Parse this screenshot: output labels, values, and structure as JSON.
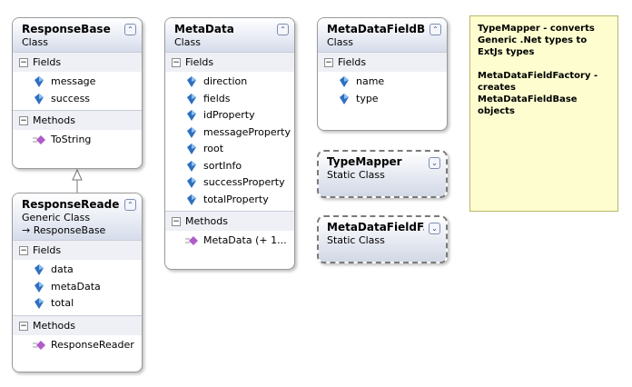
{
  "classes": {
    "response_base": {
      "name": "ResponseBase",
      "kind": "Class",
      "fields_label": "Fields",
      "fields": [
        "message",
        "success"
      ],
      "methods_label": "Methods",
      "methods": [
        "ToString"
      ]
    },
    "response_reader": {
      "name": "ResponseReade...",
      "kind": "Generic Class",
      "inherits": "→ ResponseBase",
      "fields_label": "Fields",
      "fields": [
        "data",
        "metaData",
        "total"
      ],
      "methods_label": "Methods",
      "methods": [
        "ResponseReader"
      ]
    },
    "metadata": {
      "name": "MetaData",
      "kind": "Class",
      "fields_label": "Fields",
      "fields": [
        "direction",
        "fields",
        "idProperty",
        "messageProperty",
        "root",
        "sortInfo",
        "successProperty",
        "totalProperty"
      ],
      "methods_label": "Methods",
      "methods": [
        "MetaData (+ 1..."
      ]
    },
    "metadata_field_base": {
      "name": "MetaDataFieldB...",
      "kind": "Class",
      "fields_label": "Fields",
      "fields": [
        "name",
        "type"
      ]
    },
    "type_mapper": {
      "name": "TypeMapper",
      "kind": "Static Class"
    },
    "metadata_field_factory": {
      "name": "MetaDataFieldF...",
      "kind": "Static Class"
    }
  },
  "note": {
    "line1": "TypeMapper - converts Generic .Net types to ExtJs types",
    "line2": "MetaDataFieldFactory - creates MetaDataFieldBase objects"
  },
  "icons": {
    "collapse": "double-chevron-up-icon",
    "expand": "double-chevron-down-icon",
    "field": "field-icon",
    "method": "method-icon"
  },
  "colors": {
    "note_bg": "#fdfdcf",
    "header_gradient": "#d6dcea",
    "field_icon": "#2f6fbf",
    "method_icon": "#b05cc8"
  }
}
